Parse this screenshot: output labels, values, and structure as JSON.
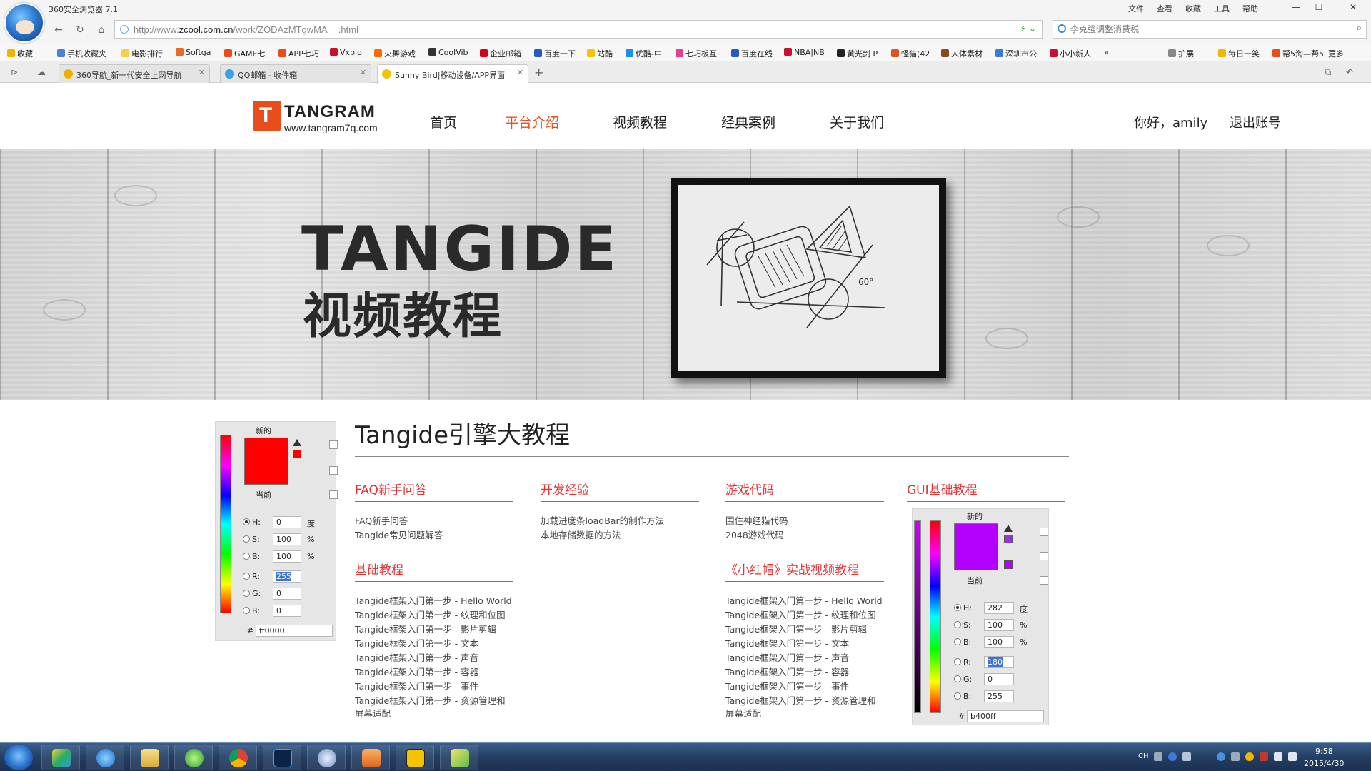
{
  "browser": {
    "app_title": "360安全浏览器 7.1",
    "menus": [
      "文件",
      "查看",
      "收藏",
      "工具",
      "帮助"
    ],
    "window_controls": [
      "—",
      "☐",
      "✕"
    ],
    "url_prefix": "http://www.",
    "url_domain": "zcool.com.cn",
    "url_path": "/work/ZODAzMTgwMA==.html",
    "search_placeholder": "李克强调整消费税",
    "bookmarks": [
      "收藏",
      "手机收藏夹",
      "电影排行",
      "Softga",
      "GAME七",
      "APP七巧",
      "Vxplo",
      "火舞游戏",
      "CoolVib",
      "企业邮箱",
      "百度一下",
      "站酷",
      "优酷-中",
      "七巧板互",
      "百度在线",
      "NBA|NB",
      "黄光剑 P",
      "怪猫(42",
      "人体素材",
      "深圳市公",
      "小小新人",
      "扩展",
      "每日一笑",
      "帮5淘—帮5",
      "更多"
    ],
    "tabs": [
      {
        "label": "360导航_新一代安全上网导航",
        "icon_color": "#f0b000",
        "active": false
      },
      {
        "label": "QQ邮箱 - 收件箱",
        "icon_color": "#3aa0e8",
        "active": false
      },
      {
        "label": "Sunny Bird|移动设备/APP界面",
        "icon_color": "#f5c400",
        "active": true
      }
    ],
    "new_tab": "+"
  },
  "site": {
    "logo_name": "TANGRAM",
    "logo_url": "www.tangram7q.com",
    "nav": [
      "首页",
      "平台介绍",
      "视频教程",
      "经典案例",
      "关于我们"
    ],
    "nav_current_index": 1,
    "greeting": "你好，amily",
    "logout": "退出账号"
  },
  "banner": {
    "title": "TANGIDE",
    "subtitle": "视频教程",
    "sketch_angle": "60°"
  },
  "content": {
    "title": "Tangide引擎大教程",
    "sections": {
      "faq": {
        "title": "FAQ新手问答",
        "links": [
          "FAQ新手问答",
          "Tangide常见问题解答"
        ]
      },
      "dev": {
        "title": "开发经验",
        "links": [
          "加载进度条loadBar的制作方法",
          "本地存储数据的方法"
        ]
      },
      "game": {
        "title": "游戏代码",
        "links": [
          "围住神经猫代码",
          "2048游戏代码"
        ]
      },
      "gui": {
        "title": "GUI基础教程"
      },
      "basic": {
        "title": "基础教程",
        "links": [
          "Tangide框架入门第一步 - Hello World",
          "Tangide框架入门第一步 - 纹理和位图",
          "Tangide框架入门第一步 - 影片剪辑",
          "Tangide框架入门第一步 - 文本",
          "Tangide框架入门第一步 - 声音",
          "Tangide框架入门第一步 - 容器",
          "Tangide框架入门第一步 - 事件",
          "Tangide框架入门第一步 - 资源管理和",
          "屏幕适配"
        ]
      },
      "video": {
        "title": "《小红帽》实战视频教程",
        "links": [
          "Tangide框架入门第一步 - Hello World",
          "Tangide框架入门第一步 - 纹理和位图",
          "Tangide框架入门第一步 - 影片剪辑",
          "Tangide框架入门第一步 - 文本",
          "Tangide框架入门第一步 - 声音",
          "Tangide框架入门第一步 - 容器",
          "Tangide框架入门第一步 - 事件",
          "Tangide框架入门第一步 - 资源管理和",
          "屏幕适配"
        ]
      }
    }
  },
  "picker_left": {
    "new_label": "新的",
    "current_label": "当前",
    "color": "#ff0000",
    "h": "0",
    "s": "100",
    "b": "100",
    "r": "255",
    "g": "0",
    "bl": "0",
    "hex": "ff0000",
    "deg": "度",
    "pct": "%",
    "labels": {
      "h": "H:",
      "s": "S:",
      "b": "B:",
      "r": "R:",
      "g": "G:",
      "bl": "B:",
      "hash": "#"
    }
  },
  "picker_right": {
    "new_label": "新的",
    "current_label": "当前",
    "color": "#b400ff",
    "h": "282",
    "s": "100",
    "b": "100",
    "r": "180",
    "g": "0",
    "bl": "255",
    "hex": "b400ff",
    "deg": "度",
    "pct": "%",
    "labels": {
      "h": "H:",
      "s": "S:",
      "b": "B:",
      "r": "R:",
      "g": "G:",
      "bl": "B:",
      "hash": "#"
    }
  },
  "taskbar": {
    "lang": "CH",
    "time": "9:58",
    "date": "2015/4/30"
  }
}
